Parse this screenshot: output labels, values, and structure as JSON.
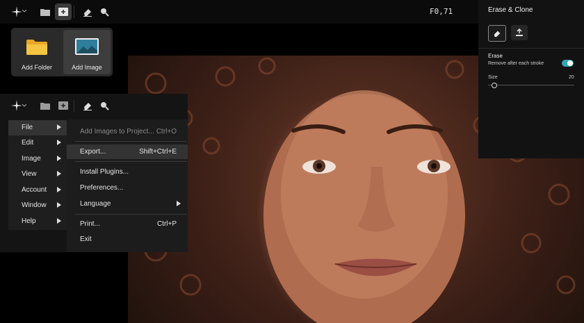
{
  "toolbar": {
    "coords": "F0,71"
  },
  "add_popup": {
    "add_folder": "Add Folder",
    "add_image": "Add Image"
  },
  "main_menu": {
    "items": [
      {
        "label": "File"
      },
      {
        "label": "Edit"
      },
      {
        "label": "Image"
      },
      {
        "label": "View"
      },
      {
        "label": "Account"
      },
      {
        "label": "Window"
      },
      {
        "label": "Help"
      }
    ]
  },
  "file_menu": {
    "items": [
      {
        "label": "Add Images to Project...",
        "shortcut": "Ctrl+O"
      },
      {
        "label": "Export...",
        "shortcut": "Shift+Ctrl+E"
      },
      {
        "label": "Install Plugins...",
        "shortcut": ""
      },
      {
        "label": "Preferences...",
        "shortcut": ""
      },
      {
        "label": "Language",
        "shortcut": ""
      },
      {
        "label": "Print...",
        "shortcut": "Ctrl+P"
      },
      {
        "label": "Exit",
        "shortcut": ""
      }
    ]
  },
  "panel": {
    "title": "Erase & Clone",
    "section": "Erase",
    "option_label": "Remove after each stroke",
    "option_enabled": true,
    "size_label": "Size",
    "size_value": "20"
  },
  "colors": {
    "accent_toggle": "#34a4b8"
  }
}
